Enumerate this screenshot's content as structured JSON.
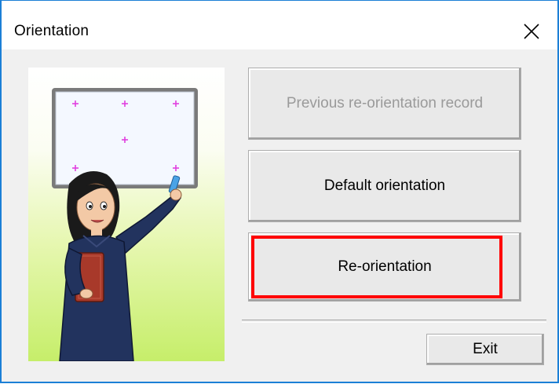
{
  "window": {
    "title": "Orientation",
    "close_icon": "close-icon"
  },
  "buttons": {
    "previous_record": "Previous re-orientation record",
    "default_orientation": "Default orientation",
    "re_orientation": "Re-orientation",
    "exit": "Exit"
  },
  "states": {
    "previous_record_enabled": false
  },
  "colors": {
    "window_border": "#1b7fd6",
    "highlight": "#ff0000",
    "crosshair": "#e040e0",
    "disabled_text": "#9a9a9a"
  },
  "illustration": {
    "description_icon": "teacher-pointing-at-board-icon"
  }
}
